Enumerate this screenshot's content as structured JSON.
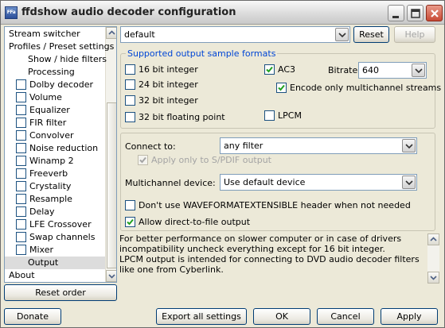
{
  "window": {
    "title": "ffdshow audio decoder configuration",
    "icon_text": "FFa"
  },
  "tree": {
    "items": [
      {
        "label": "Stream switcher",
        "checkbox": false,
        "indent": 0,
        "selected": false
      },
      {
        "label": "Profiles / Preset settings",
        "checkbox": false,
        "indent": 0,
        "selected": false
      },
      {
        "label": "Show / hide filters",
        "checkbox": false,
        "indent": 2,
        "selected": false
      },
      {
        "label": "Processing",
        "checkbox": false,
        "indent": 2,
        "selected": false
      },
      {
        "label": "Dolby decoder",
        "checkbox": true,
        "checked": false,
        "indent": 1,
        "selected": false
      },
      {
        "label": "Volume",
        "checkbox": true,
        "checked": false,
        "indent": 1,
        "selected": false
      },
      {
        "label": "Equalizer",
        "checkbox": true,
        "checked": false,
        "indent": 1,
        "selected": false
      },
      {
        "label": "FIR filter",
        "checkbox": true,
        "checked": false,
        "indent": 1,
        "selected": false
      },
      {
        "label": "Convolver",
        "checkbox": true,
        "checked": false,
        "indent": 1,
        "selected": false
      },
      {
        "label": "Noise reduction",
        "checkbox": true,
        "checked": false,
        "indent": 1,
        "selected": false
      },
      {
        "label": "Winamp 2",
        "checkbox": true,
        "checked": false,
        "indent": 1,
        "selected": false
      },
      {
        "label": "Freeverb",
        "checkbox": true,
        "checked": false,
        "indent": 1,
        "selected": false
      },
      {
        "label": "Crystality",
        "checkbox": true,
        "checked": false,
        "indent": 1,
        "selected": false
      },
      {
        "label": "Resample",
        "checkbox": true,
        "checked": false,
        "indent": 1,
        "selected": false
      },
      {
        "label": "Delay",
        "checkbox": true,
        "checked": false,
        "indent": 1,
        "selected": false
      },
      {
        "label": "LFE Crossover",
        "checkbox": true,
        "checked": false,
        "indent": 1,
        "selected": false
      },
      {
        "label": "Swap channels",
        "checkbox": true,
        "checked": false,
        "indent": 1,
        "selected": false
      },
      {
        "label": "Mixer",
        "checkbox": true,
        "checked": false,
        "indent": 1,
        "selected": false
      },
      {
        "label": "Output",
        "checkbox": false,
        "indent": 2,
        "selected": true
      },
      {
        "label": "About",
        "checkbox": false,
        "indent": 0,
        "selected": false
      }
    ],
    "reset_order_label": "Reset order"
  },
  "preset": {
    "value": "default",
    "reset_label": "Reset",
    "help_label": "Help"
  },
  "formats": {
    "title": "Supported output sample formats",
    "int16": {
      "label": "16 bit integer",
      "checked": false
    },
    "int24": {
      "label": "24 bit integer",
      "checked": false
    },
    "int32": {
      "label": "32 bit integer",
      "checked": false
    },
    "float32": {
      "label": "32 bit floating point",
      "checked": false
    },
    "ac3": {
      "label": "AC3",
      "checked": true
    },
    "bitrate_label": "Bitrate:",
    "bitrate_value": "640",
    "encode_multi": {
      "label": "Encode only multichannel streams",
      "checked": true
    },
    "lpcm": {
      "label": "LPCM",
      "checked": false
    }
  },
  "connect": {
    "label": "Connect to:",
    "value": "any filter",
    "spdif": {
      "label": "Apply only to S/PDIF output",
      "checked": true,
      "disabled": true
    },
    "multichannel_label": "Multichannel device:",
    "multichannel_value": "Use default device",
    "waveformat": {
      "label": "Don't use WAVEFORMATEXTENSIBLE header when not needed",
      "checked": false
    },
    "direct_file": {
      "label": "Allow direct-to-file output",
      "checked": true
    }
  },
  "info_text": "For better performance on slower computer or in case of drivers incompatibility uncheck everything except for 16 bit integer.\nLPCM output is intended for connecting to DVD audio decoder filters like one from Cyberlink.",
  "buttons": {
    "donate": "Donate",
    "export": "Export all settings",
    "ok": "OK",
    "cancel": "Cancel",
    "apply": "Apply"
  },
  "colors": {
    "accent": "#0046d5",
    "window_bg": "#ece9d8",
    "check": "#21a121"
  }
}
